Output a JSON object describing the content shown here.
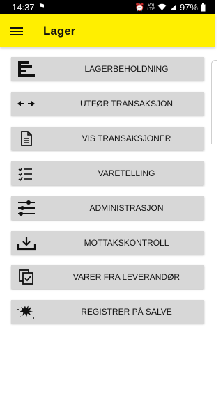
{
  "status_bar": {
    "time": "14:37",
    "battery": "97%",
    "network": "VoLTE LTE"
  },
  "app_bar": {
    "title": "Lager"
  },
  "menu": {
    "items": [
      {
        "label": "LAGERBEHOLDNING",
        "icon": "inventory-bars-icon"
      },
      {
        "label": "UTFØR TRANSAKSJON",
        "icon": "swap-arrows-icon"
      },
      {
        "label": "VIS TRANSAKSJONER",
        "icon": "document-icon"
      },
      {
        "label": "VARETELLING",
        "icon": "checklist-icon"
      },
      {
        "label": "ADMINISTRASJON",
        "icon": "sliders-icon"
      },
      {
        "label": "MOTTAKSKONTROLL",
        "icon": "download-tray-icon"
      },
      {
        "label": "VARER FRA LEVERANDØR",
        "icon": "clipboard-check-icon"
      },
      {
        "label": "REGISTRER PÅ SALVE",
        "icon": "explosion-icon"
      }
    ]
  }
}
